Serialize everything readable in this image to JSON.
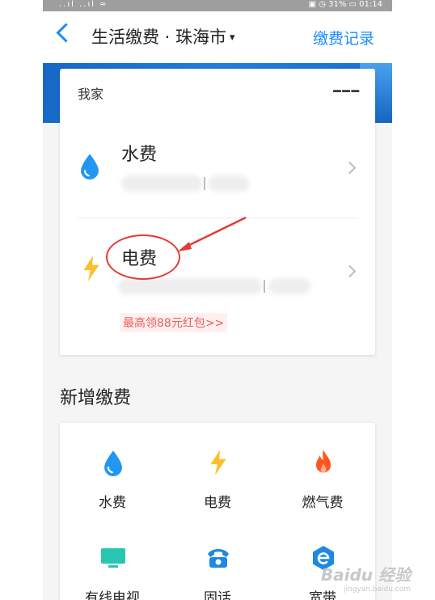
{
  "status_bar": {
    "signal": "..ıl ..ıl ≈",
    "right": "▣ ◷ 31% ▭ 01:14"
  },
  "header": {
    "title": "生活缴费 · 珠海市",
    "caret": "▾",
    "records_label": "缴费记录"
  },
  "my_home": {
    "title": "我家",
    "more": "···",
    "items": [
      {
        "label": "水费",
        "icon": "water-drop-icon"
      },
      {
        "label": "电费",
        "icon": "lightning-icon"
      }
    ],
    "promo": "最高领88元红包>>"
  },
  "new_payment": {
    "title": "新增缴费",
    "tiles": [
      {
        "label": "水费",
        "icon": "water-drop-icon"
      },
      {
        "label": "电费",
        "icon": "lightning-icon"
      },
      {
        "label": "燃气费",
        "icon": "flame-icon"
      },
      {
        "label": "有线电视",
        "icon": "tv-icon"
      },
      {
        "label": "固话",
        "icon": "telephone-icon"
      },
      {
        "label": "宽带",
        "icon": "broadband-e-icon"
      }
    ]
  },
  "watermark": {
    "main": "Baidu 经验",
    "sub": "jingyan.baidu.com"
  },
  "colors": {
    "accent": "#1a8cff",
    "water": "#2196f3",
    "electric": "#fbc02d",
    "gas": "#ff5722",
    "annotation": "#e53935"
  }
}
